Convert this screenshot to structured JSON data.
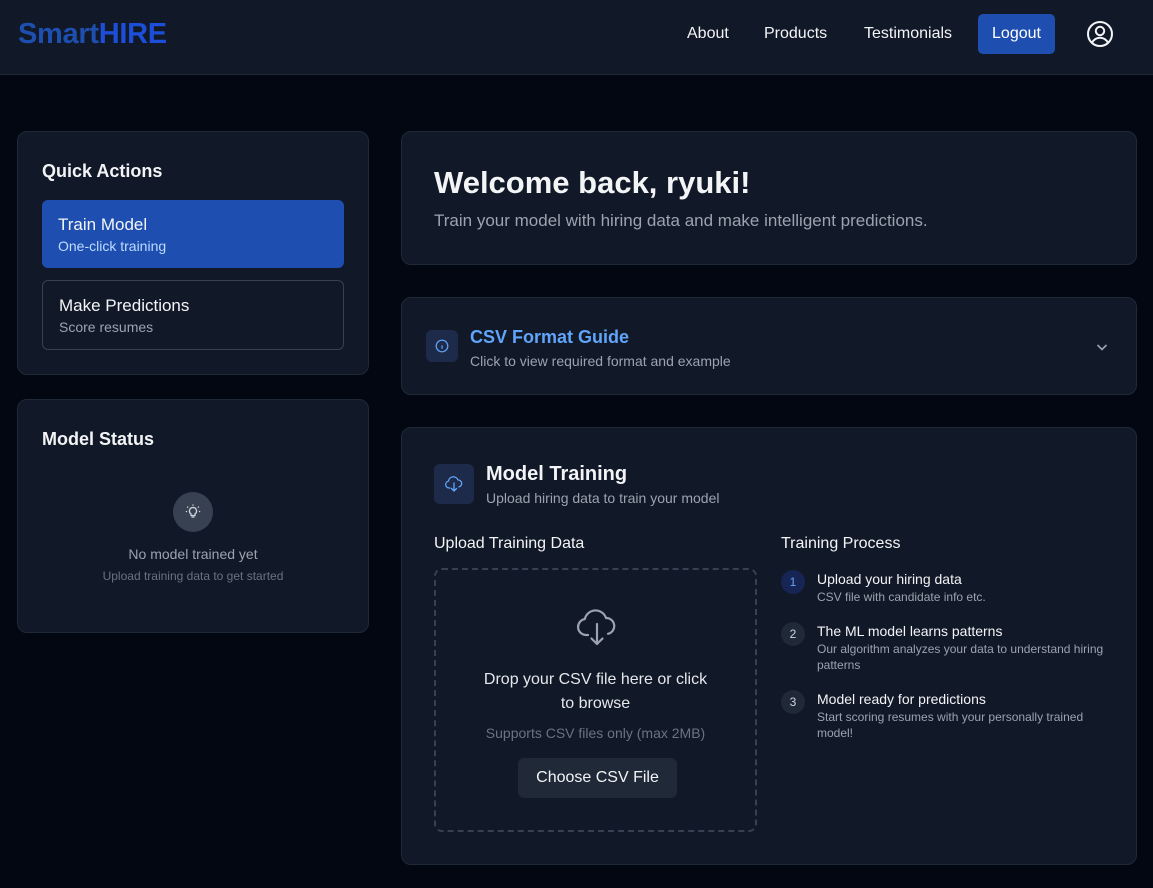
{
  "header": {
    "logo_part1": "Smart",
    "logo_part2": "HIRE",
    "nav": [
      "About",
      "Products",
      "Testimonials"
    ],
    "logout_label": "Logout",
    "user_icon": "user-circle-icon"
  },
  "quick_actions": {
    "title": "Quick Actions",
    "items": [
      {
        "label": "Train Model",
        "sub": "One-click training",
        "active": true
      },
      {
        "label": "Make Predictions",
        "sub": "Score resumes",
        "active": false
      }
    ]
  },
  "model_status": {
    "title": "Model Status",
    "icon": "lightbulb-icon",
    "message": "No model trained yet",
    "hint": "Upload training data to get started"
  },
  "welcome": {
    "title": "Welcome back, ryuki!",
    "subtitle": "Train your model with hiring data and make intelligent predictions."
  },
  "csv_guide": {
    "icon": "info-icon",
    "title": "CSV Format Guide",
    "subtitle": "Click to view required format and example",
    "toggle_icon": "chevron-down-icon"
  },
  "training": {
    "icon": "cloud-download-icon",
    "title": "Model Training",
    "subtitle": "Upload hiring data to train your model",
    "upload": {
      "heading": "Upload Training Data",
      "drop_line1": "Drop your CSV file here or click",
      "drop_line2": "to browse",
      "supports": "Supports CSV files only (max 2MB)",
      "button_label": "Choose CSV File"
    },
    "process": {
      "heading": "Training Process",
      "steps": [
        {
          "num": "1",
          "title": "Upload your hiring data",
          "desc": "CSV file with candidate info etc."
        },
        {
          "num": "2",
          "title": "The ML model learns patterns",
          "desc": "Our algorithm analyzes your data to understand hiring patterns"
        },
        {
          "num": "3",
          "title": "Model ready for predictions",
          "desc": "Start scoring resumes with your personally trained model!"
        }
      ]
    }
  },
  "colors": {
    "background": "#030712",
    "card": "#111827",
    "accent": "#1e4fb0",
    "link": "#60a5fa"
  }
}
